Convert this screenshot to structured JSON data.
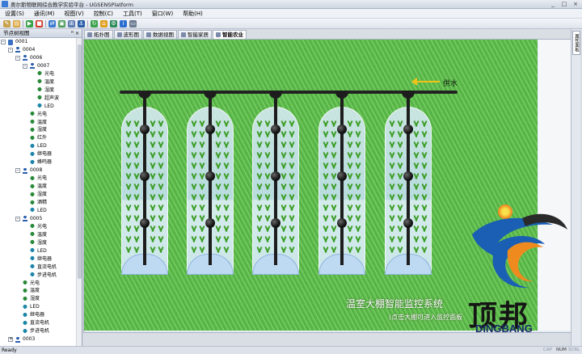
{
  "window": {
    "title": "奥尔斯物联网综合教学实验平台 - UGSENSPlatform",
    "buttons": [
      "_",
      "□",
      "×"
    ]
  },
  "menu": [
    "设置(S)",
    "通讯(M)",
    "视图(V)",
    "控制(C)",
    "工具(T)",
    "窗口(W)",
    "帮助(H)"
  ],
  "toolbar_icons": [
    "new-icon",
    "open-icon",
    "play-icon",
    "stop-icon",
    "connect-icon",
    "image-icon",
    "link-icon",
    "anchor-icon",
    "refresh-icon",
    "home-icon",
    "settings-icon",
    "info-icon",
    "monitor-icon"
  ],
  "tree_panel": {
    "title": "节点树视图",
    "pin": "ꟸ ×",
    "rows": [
      {
        "label": "0001",
        "type": "root",
        "indent": 0,
        "expander": "-"
      },
      {
        "label": "0004",
        "type": "router",
        "indent": 1,
        "expander": "-"
      },
      {
        "label": "0006",
        "type": "router",
        "indent": 2,
        "expander": "-"
      },
      {
        "label": "0007",
        "type": "router",
        "indent": 3,
        "expander": "-"
      },
      {
        "label": "光电",
        "type": "sensor",
        "indent": 4
      },
      {
        "label": "温度",
        "type": "sensor",
        "indent": 4
      },
      {
        "label": "湿度",
        "type": "sensor",
        "indent": 4
      },
      {
        "label": "超声波",
        "type": "sensor",
        "indent": 4
      },
      {
        "label": "LED",
        "type": "device",
        "indent": 4
      },
      {
        "label": "光电",
        "type": "sensor",
        "indent": 3
      },
      {
        "label": "温度",
        "type": "sensor",
        "indent": 3
      },
      {
        "label": "湿度",
        "type": "sensor",
        "indent": 3
      },
      {
        "label": "红外",
        "type": "sensor",
        "indent": 3
      },
      {
        "label": "LED",
        "type": "device",
        "indent": 3
      },
      {
        "label": "继电器",
        "type": "device",
        "indent": 3
      },
      {
        "label": "蜂鸣器",
        "type": "device",
        "indent": 3
      },
      {
        "label": "0008",
        "type": "router",
        "indent": 2,
        "expander": "-"
      },
      {
        "label": "光电",
        "type": "sensor",
        "indent": 3
      },
      {
        "label": "温度",
        "type": "sensor",
        "indent": 3
      },
      {
        "label": "湿度",
        "type": "sensor",
        "indent": 3
      },
      {
        "label": "酒精",
        "type": "sensor",
        "indent": 3
      },
      {
        "label": "LED",
        "type": "device",
        "indent": 3
      },
      {
        "label": "0005",
        "type": "router",
        "indent": 2,
        "expander": "-"
      },
      {
        "label": "光电",
        "type": "sensor",
        "indent": 3
      },
      {
        "label": "温度",
        "type": "sensor",
        "indent": 3
      },
      {
        "label": "湿度",
        "type": "sensor",
        "indent": 3
      },
      {
        "label": "LED",
        "type": "device",
        "indent": 3
      },
      {
        "label": "继电器",
        "type": "device",
        "indent": 3
      },
      {
        "label": "直流电机",
        "type": "device",
        "indent": 3
      },
      {
        "label": "步进电机",
        "type": "device",
        "indent": 3
      },
      {
        "label": "光电",
        "type": "sensor",
        "indent": 2
      },
      {
        "label": "温度",
        "type": "sensor",
        "indent": 2
      },
      {
        "label": "湿度",
        "type": "sensor",
        "indent": 2
      },
      {
        "label": "LED",
        "type": "device",
        "indent": 2
      },
      {
        "label": "继电器",
        "type": "device",
        "indent": 2
      },
      {
        "label": "直流电机",
        "type": "device",
        "indent": 2
      },
      {
        "label": "步进电机",
        "type": "device",
        "indent": 2
      },
      {
        "label": "0003",
        "type": "router",
        "indent": 1,
        "expander": "+"
      }
    ]
  },
  "tabs": [
    {
      "label": "拓扑图",
      "active": false
    },
    {
      "label": "波形图",
      "active": false
    },
    {
      "label": "数据视图",
      "active": false
    },
    {
      "label": "智能家居",
      "active": false
    },
    {
      "label": "智能农业",
      "active": true
    }
  ],
  "right_dock": {
    "label": "属性面板"
  },
  "scene": {
    "supply_label": "供水",
    "greenhouse_count": 5,
    "system_title": "温室大棚智能监控系统",
    "system_hint": "(点击大棚可进入监控面板"
  },
  "logo": {
    "cn": "顶邦",
    "en": "DINGBANG"
  },
  "status": {
    "text": "Ready",
    "indicators": [
      "CAP",
      "NUM",
      "SCRL"
    ]
  },
  "colors": {
    "field_green": "#5ab84a",
    "pipe": "#1d1d1d",
    "supply_arrow": "#f2c21a",
    "logo_blue": "#1a5fb4",
    "logo_orange": "#ef8a1e"
  }
}
